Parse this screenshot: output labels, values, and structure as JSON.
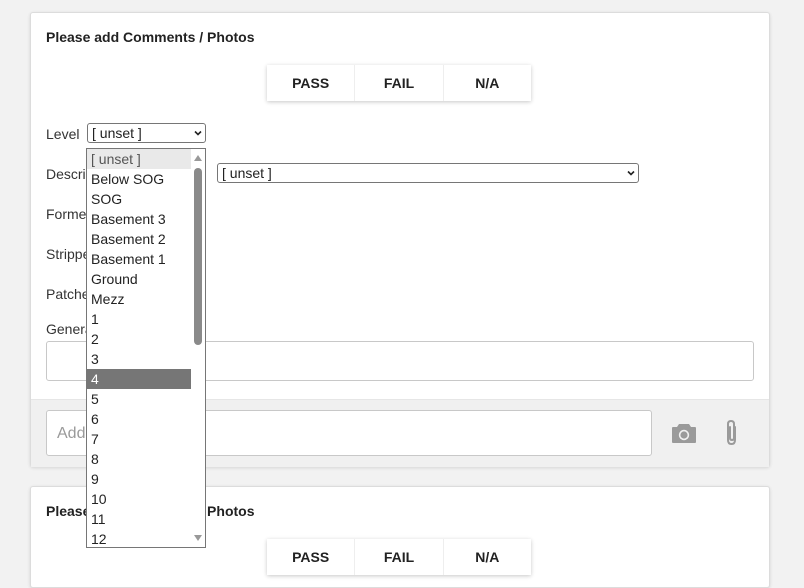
{
  "cards": [
    {
      "title": "Please add Comments / Photos",
      "toggle": [
        "PASS",
        "FAIL",
        "N/A"
      ],
      "fields": {
        "level_label": "Level",
        "level_value": "[ unset ]",
        "description_label": "Description",
        "description_value": "[ unset ]",
        "formed_label": "Formed",
        "stripped_label": "Stripped",
        "patched_label": "Patched",
        "general_label": "General"
      },
      "comment_placeholder": "Add a comment..."
    },
    {
      "title": "Please add Comments / Photos",
      "toggle": [
        "PASS",
        "FAIL",
        "N/A"
      ]
    }
  ],
  "level_dropdown": {
    "options": [
      "[ unset ]",
      "Below SOG",
      "SOG",
      "Basement 3",
      "Basement 2",
      "Basement 1",
      "Ground",
      "Mezz",
      "1",
      "2",
      "3",
      "4",
      "5",
      "6",
      "7",
      "8",
      "9",
      "10",
      "11",
      "12"
    ],
    "selected_index": 0,
    "highlighted_index": 11
  },
  "icons": {
    "camera": "camera-icon",
    "attach": "paperclip-icon",
    "select_arrow": "chevron-down-icon",
    "scroll_up": "triangle-up-icon",
    "scroll_down": "triangle-down-icon"
  },
  "colors": {
    "icon_gray": "#9a9a9a",
    "highlight": "#767676",
    "scroll_thumb": "#8a8a8a"
  }
}
